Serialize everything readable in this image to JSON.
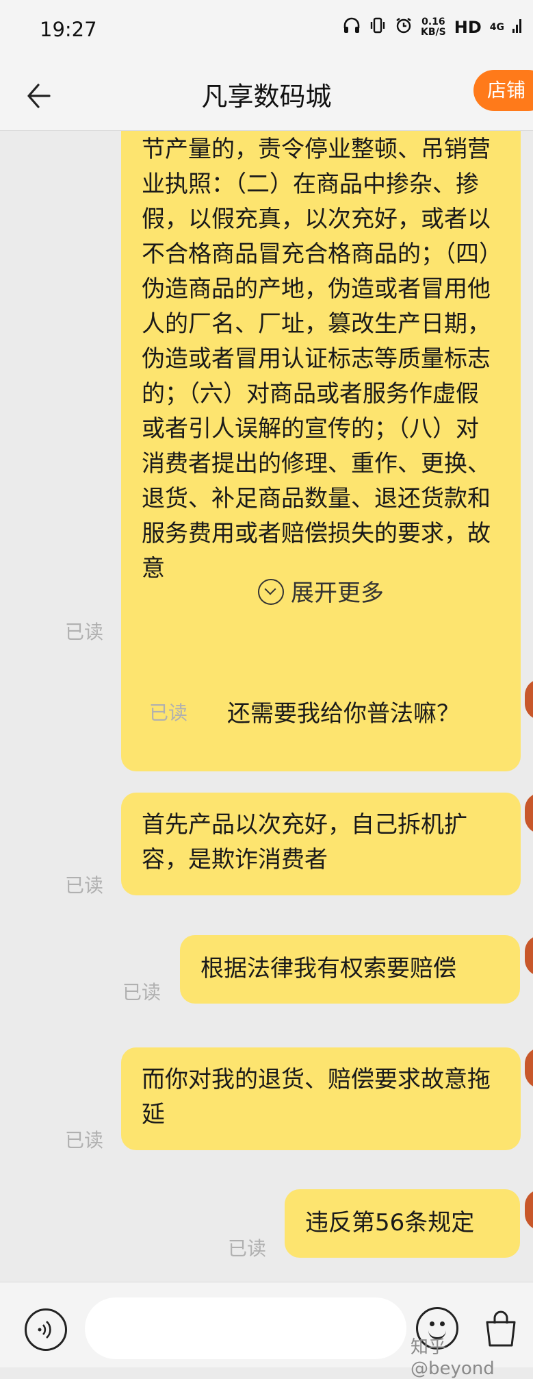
{
  "status_bar": {
    "time": "19:27",
    "speed_value": "0.16",
    "speed_unit": "KB/S",
    "hd": "HD",
    "network": "4G",
    "icons": [
      "headphones-icon",
      "vibrate-icon",
      "alarm-icon",
      "signal-icon"
    ]
  },
  "header": {
    "back_icon": "back-arrow-icon",
    "title": "凡享数码城",
    "shop_label": "店铺",
    "shop_color": "#ff7a1a"
  },
  "messages": [
    {
      "side": "left",
      "text": "节产量的，责令停业整顿、吊销营业执照：（二）在商品中掺杂、掺假，以假充真，以次充好，或者以不合格商品冒充合格商品的；（四）伪造商品的产地，伪造或者冒用他人的厂名、厂址，篡改生产日期，伪造或者冒用认证标志等质量标志的；（六）对商品或者服务作虚假或者引人误解的宣传的；（八）对消费者提出的修理、重作、更换、退货、补足商品数量、退还货款和服务费用或者赔偿损失的要求，故意",
      "expand_label": "展开更多",
      "read": "已读"
    },
    {
      "side": "right",
      "text": "还需要我给你普法嘛？",
      "read": "已读"
    },
    {
      "side": "right",
      "text": "首先产品以次充好，自己拆机扩容，是欺诈消费者",
      "read": "已读"
    },
    {
      "side": "right",
      "text": "根据法律我有权索要赔偿",
      "read": "已读"
    },
    {
      "side": "right",
      "text": "而你对我的退货、赔偿要求故意拖延",
      "read": "已读"
    },
    {
      "side": "right",
      "text": "违反第56条规定",
      "read": "已读"
    }
  ],
  "input_bar": {
    "voice_icon": "voice-icon",
    "placeholder": "",
    "emoji_icon": "emoji-icon",
    "bag_icon": "shopping-bag-icon"
  },
  "watermark": "知乎 @beyond",
  "colors": {
    "bubble": "#fde46f",
    "background": "#ebebeb"
  }
}
